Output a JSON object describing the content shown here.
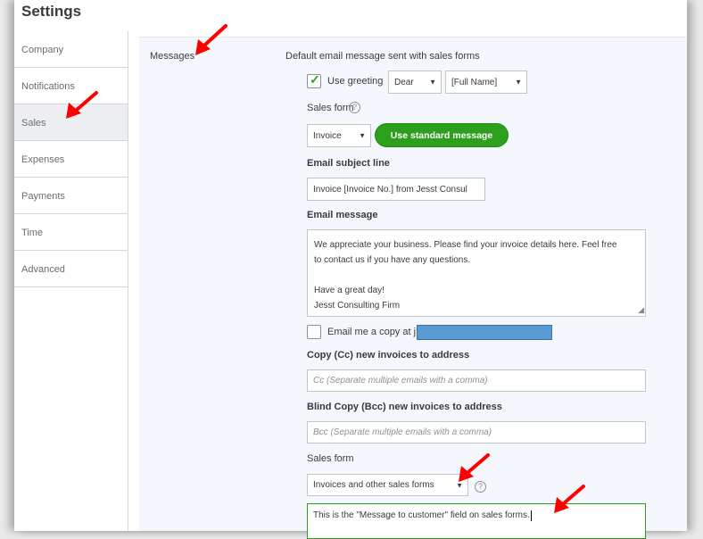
{
  "window": {
    "title": "Settings"
  },
  "sidebar": {
    "items": [
      {
        "label": "Company"
      },
      {
        "label": "Notifications"
      },
      {
        "label": "Sales",
        "selected": true
      },
      {
        "label": "Expenses"
      },
      {
        "label": "Payments"
      },
      {
        "label": "Time"
      },
      {
        "label": "Advanced"
      }
    ]
  },
  "messages": {
    "section_label": "Messages",
    "heading": "Default email message sent with sales forms",
    "use_greeting_label": "Use greeting",
    "use_greeting_checked": true,
    "greeting_value": "Dear",
    "name_value": "[Full Name]",
    "sales_form_label": "Sales form",
    "help_icon": "?",
    "sales_form_value": "Invoice",
    "use_standard_button": "Use standard message",
    "subject_label": "Email subject line",
    "subject_value": "Invoice [Invoice No.] from Jesst Consul",
    "message_label": "Email message",
    "message_lines": [
      "We appreciate your business. Please find your invoice details here. Feel free",
      "to contact us if you have any questions.",
      "",
      "Have a great day!",
      "Jesst Consulting Firm"
    ],
    "email_copy_label": "Email me a copy at j",
    "email_copy_checked": false,
    "cc_label": "Copy (Cc) new invoices to address",
    "cc_placeholder": "Cc (Separate multiple emails with a comma)",
    "bcc_label": "Blind Copy (Bcc) new invoices to address",
    "bcc_placeholder": "Bcc (Separate multiple emails with a comma)",
    "sales_form2_label": "Sales form",
    "sales_form2_value": "Invoices and other sales forms",
    "customer_message": "This is the \"Message to customer\" field on sales forms."
  },
  "colors": {
    "accent": "#2ca01c",
    "panel": "#f4f8fd",
    "redaction": "#5b9bd5",
    "arrow": "#ff0000"
  }
}
